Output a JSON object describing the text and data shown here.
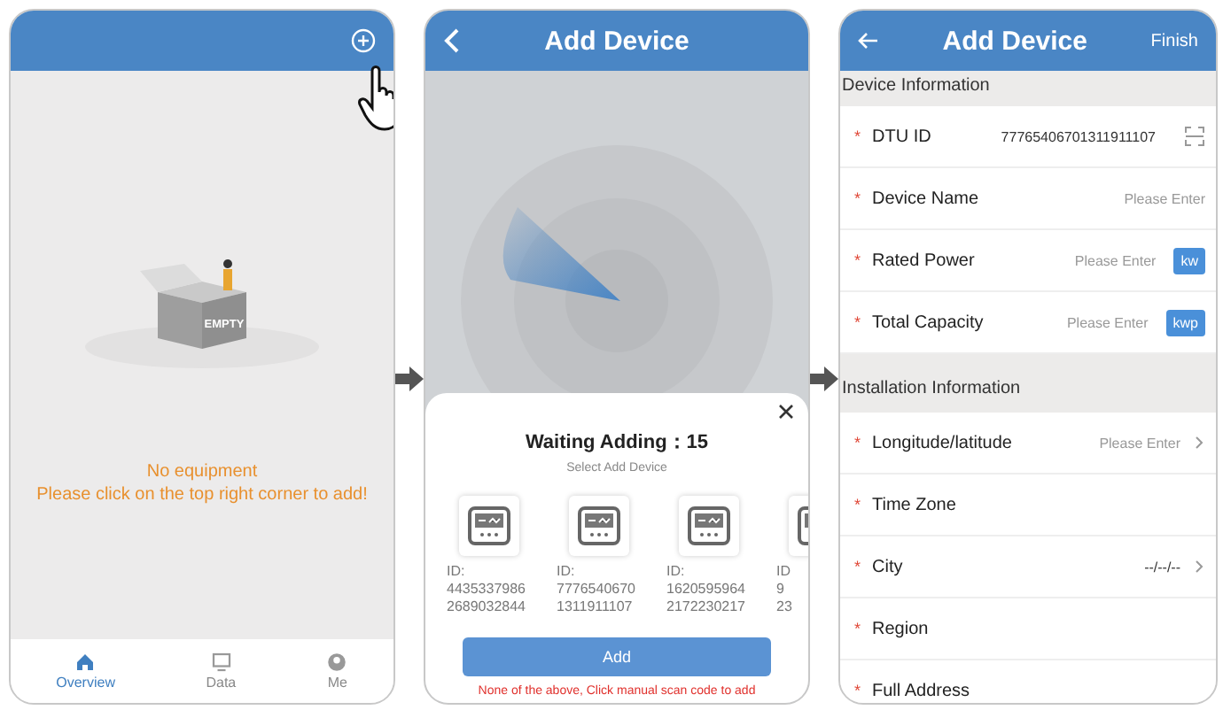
{
  "overview_screen": {
    "illustration_label": "EMPTY",
    "empty_title": "No equipment",
    "empty_hint": "Please click on the top right corner to add!",
    "tabs": [
      {
        "label": "Overview",
        "selected": true
      },
      {
        "label": "Data",
        "selected": false
      },
      {
        "label": "Me",
        "selected": false
      }
    ]
  },
  "scan_screen": {
    "title": "Add Device",
    "dialog": {
      "title": "Waiting Adding：15",
      "subtitle": "Select Add Device",
      "devices": [
        {
          "id_lines": [
            "ID:",
            "4435337986",
            "2689032844"
          ]
        },
        {
          "id_lines": [
            "ID:",
            "7776540670",
            "1311911107"
          ]
        },
        {
          "id_lines": [
            "ID:",
            "1620595964",
            "2172230217"
          ]
        },
        {
          "id_lines": [
            "ID",
            "9",
            "23"
          ]
        }
      ],
      "button": "Add",
      "hint": "None of the above, Click manual scan code to add"
    }
  },
  "form_screen": {
    "title": "Add Device",
    "action": "Finish",
    "sections": [
      {
        "title": "Device Information",
        "fields": [
          {
            "kind": "scan",
            "required_mark": "*",
            "label": "DTU ID",
            "value": "77765406701311911107"
          },
          {
            "kind": "input",
            "required_mark": "*",
            "label": "Device Name",
            "placeholder": "Please Enter"
          },
          {
            "kind": "unit",
            "required_mark": "*",
            "label": "Rated Power",
            "placeholder": "Please Enter",
            "unit": "kw"
          },
          {
            "kind": "unit",
            "required_mark": "*",
            "label": "Total Capacity",
            "placeholder": "Please Enter",
            "unit": "kwp"
          }
        ]
      },
      {
        "title": "Installation Information",
        "fields": [
          {
            "kind": "select",
            "required_mark": "*",
            "label": "Longitude/latitude",
            "placeholder": "Please Enter"
          },
          {
            "kind": "plain",
            "required_mark": "*",
            "label": "Time Zone"
          },
          {
            "kind": "select",
            "required_mark": "*",
            "label": "City",
            "value": "--/--/--"
          },
          {
            "kind": "plain",
            "required_mark": "*",
            "label": "Region"
          },
          {
            "kind": "plain",
            "required_mark": "*",
            "label": "Full Address"
          }
        ]
      }
    ]
  }
}
